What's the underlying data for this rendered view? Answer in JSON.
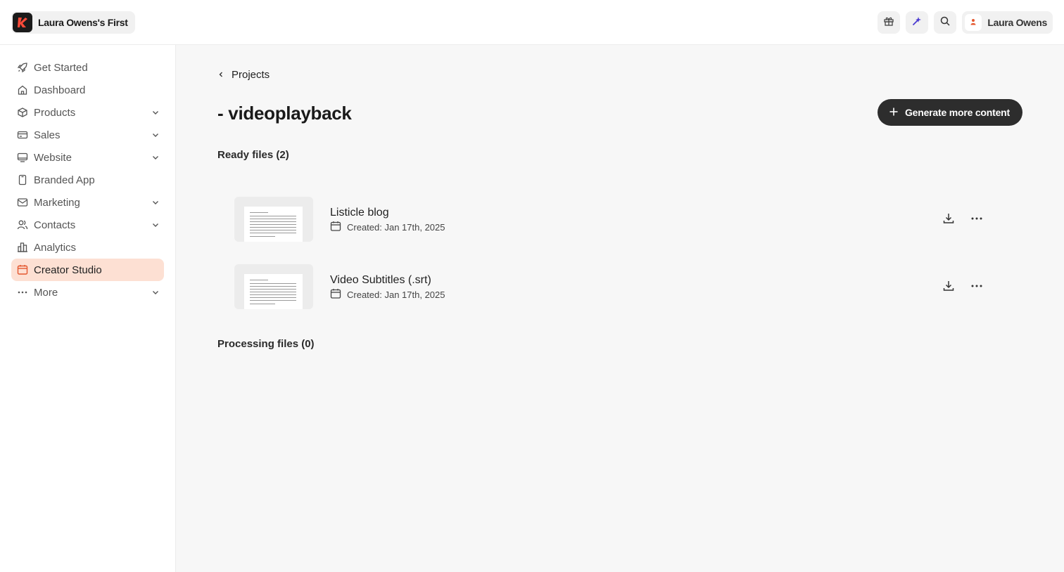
{
  "workspace": {
    "name": "Laura Owens's First"
  },
  "user": {
    "name": "Laura Owens"
  },
  "colors": {
    "accent": "#e4572e",
    "active_bg": "#fde0d3",
    "primary_button": "#2d2d2d"
  },
  "sidebar": {
    "items": [
      {
        "label": "Get Started",
        "icon": "rocket-icon"
      },
      {
        "label": "Dashboard",
        "icon": "home-icon"
      },
      {
        "label": "Products",
        "icon": "box-icon",
        "expandable": true
      },
      {
        "label": "Sales",
        "icon": "credit-card-icon",
        "expandable": true
      },
      {
        "label": "Website",
        "icon": "monitor-icon",
        "expandable": true
      },
      {
        "label": "Branded App",
        "icon": "phone-icon"
      },
      {
        "label": "Marketing",
        "icon": "mail-icon",
        "expandable": true
      },
      {
        "label": "Contacts",
        "icon": "users-icon",
        "expandable": true
      },
      {
        "label": "Analytics",
        "icon": "bar-chart-icon"
      },
      {
        "label": "Creator Studio",
        "icon": "calendar-icon",
        "active": true
      },
      {
        "label": "More",
        "icon": "ellipsis-icon",
        "expandable": true
      }
    ]
  },
  "main": {
    "breadcrumb": "Projects",
    "title": "- videoplayback",
    "generate_button": "Generate more content",
    "ready_heading": "Ready files (2)",
    "processing_heading": "Processing files (0)",
    "files": [
      {
        "name": "Listicle blog",
        "created": "Created: Jan 17th, 2025"
      },
      {
        "name": "Video Subtitles (.srt)",
        "created": "Created: Jan 17th, 2025"
      }
    ]
  }
}
